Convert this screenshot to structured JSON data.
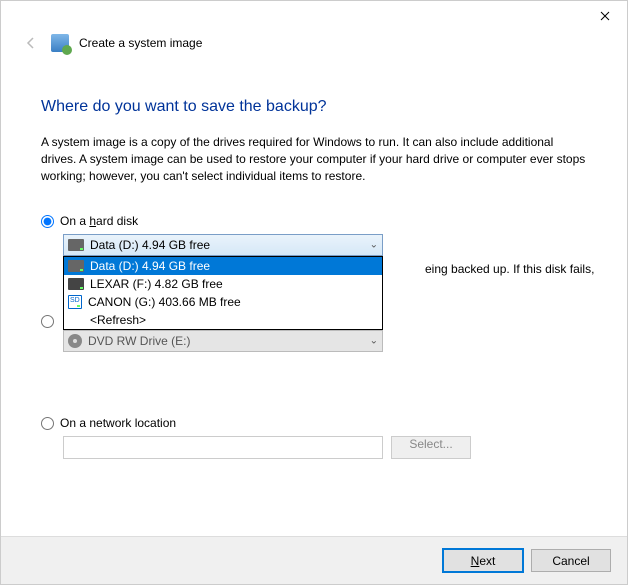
{
  "titlebar": {
    "close_tooltip": "Close"
  },
  "header": {
    "app_title": "Create a system image"
  },
  "main": {
    "heading": "Where do you want to save the backup?",
    "description": "A system image is a copy of the drives required for Windows to run. It can also include additional drives. A system image can be used to restore your computer if your hard drive or computer ever stops working; however, you can't select individual items to restore.",
    "option_hard_disk": {
      "label_pre": "On a ",
      "label_accel": "h",
      "label_post": "ard disk",
      "selected_drive": "Data (D:)  4.94 GB free",
      "warning_tail": "eing backed up. If this disk fails,",
      "dropdown": [
        {
          "type": "hdd",
          "label": "Data (D:)  4.94 GB free",
          "selected": true
        },
        {
          "type": "usb",
          "label": "LEXAR (F:)  4.82 GB free"
        },
        {
          "type": "sd",
          "label": "CANON (G:)  403.66 MB free"
        },
        {
          "type": "refresh",
          "label": "<Refresh>"
        }
      ]
    },
    "option_dvd": {
      "drive_label": "DVD RW Drive (E:)"
    },
    "option_network": {
      "label": "On a network location",
      "select_button": "Select..."
    }
  },
  "footer": {
    "next_pre": "",
    "next_u": "N",
    "next_post": "ext",
    "cancel": "Cancel"
  }
}
